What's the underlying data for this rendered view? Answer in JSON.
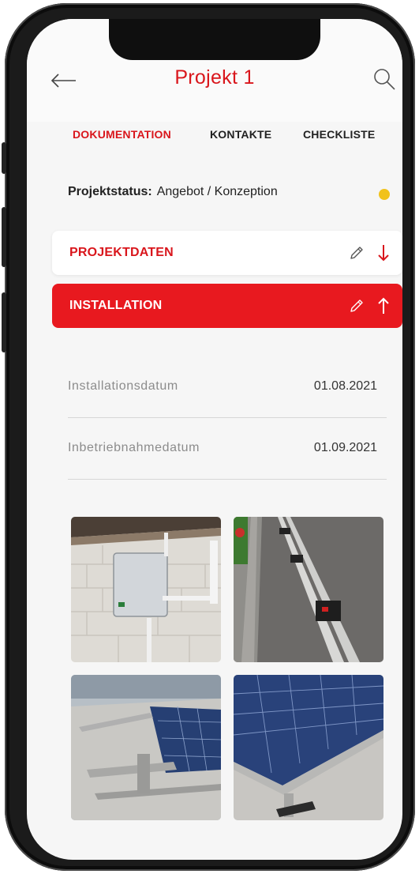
{
  "header": {
    "title": "Projekt 1"
  },
  "tabs": [
    {
      "label": "DOKUMENTATION",
      "active": true
    },
    {
      "label": "KONTAKTE",
      "active": false
    },
    {
      "label": "CHECKLISTE",
      "active": false
    }
  ],
  "status": {
    "label": "Projektstatus:",
    "value": "Angebot / Konzeption",
    "dot_color": "#f1c21b"
  },
  "sections": [
    {
      "label": "PROJEKTDATEN",
      "expanded": false
    },
    {
      "label": "INSTALLATION",
      "expanded": true
    }
  ],
  "details": [
    {
      "key": "Installationsdatum",
      "value": "01.08.2021"
    },
    {
      "key": "Inbetriebnahmedatum",
      "value": "01.09.2021"
    }
  ],
  "colors": {
    "accent": "#e8191f",
    "status_yellow": "#f1c21b"
  },
  "icons": [
    "back-arrow-icon",
    "search-icon",
    "pencil-icon",
    "arrow-down-icon",
    "arrow-up-icon"
  ]
}
